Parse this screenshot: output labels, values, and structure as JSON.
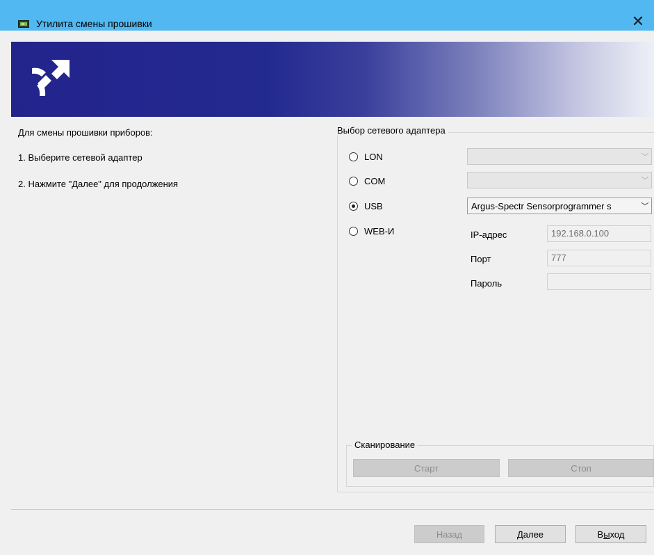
{
  "window": {
    "title": "Утилита смены прошивки",
    "close_glyph": "✕",
    "close_icon": "close-icon",
    "app_icon": "firmware-chip-icon"
  },
  "banner": {
    "logo_icon": "network-arrow-logo-icon"
  },
  "instructions": {
    "heading": "Для смены прошивки приборов:",
    "step1": "1. Выберите сетевой адаптер",
    "step2": "2. Нажмите \"Далее\" для продолжения"
  },
  "adapter": {
    "group_label": "Выбор сетевого адаптера",
    "options": [
      {
        "label": "LON",
        "checked": false,
        "combo_value": ""
      },
      {
        "label": "COM",
        "checked": false,
        "combo_value": ""
      },
      {
        "label": "USB",
        "checked": true,
        "combo_value": "Argus-Spectr Sensorprogrammer s"
      },
      {
        "label": "WEB-И",
        "checked": false
      }
    ],
    "web": {
      "ip_label": "IP-адрес",
      "ip_value": "192.168.0.100",
      "port_label": "Порт",
      "port_value": "777",
      "password_label": "Пароль",
      "password_value": ""
    }
  },
  "scan": {
    "label": "Сканирование",
    "start": "Старт",
    "stop": "Стоп"
  },
  "footer": {
    "back": "Назад",
    "next": "Далее",
    "exit_prefix": "В",
    "exit_underlined": "ы",
    "exit_suffix": "ход"
  },
  "colors": {
    "titlebar": "#52b8f2",
    "banner_dark": "#23238c"
  }
}
